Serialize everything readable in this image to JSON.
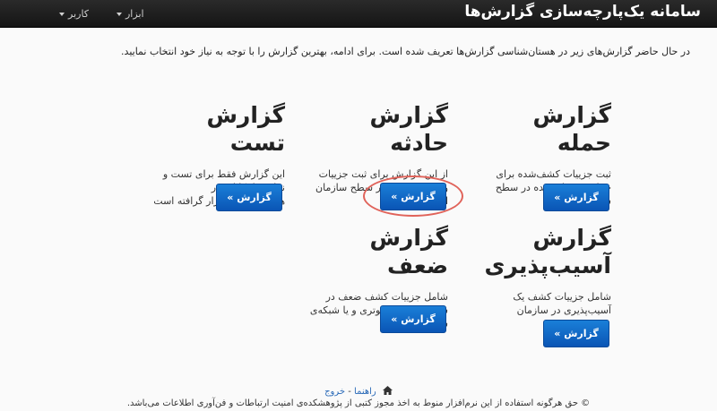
{
  "navbar": {
    "brand": "سامانه یک‌پارچه‌سازی گزارش‌ها",
    "menu_tools": "ابزار",
    "menu_user": "کاربر"
  },
  "intro": "در حال حاضر گزارش‌های زیر در هستان‌شناسی گزارش‌ها تعریف شده است. برای ادامه، بهترین گزارش را با توجه به نیاز خود انتخاب نمایید.",
  "reports": {
    "attack": {
      "title": "گزارش حمله",
      "desc": "ثبت جزییات کشف‌شده برای حمله‌ی رخ‌داده‌شده در سطح سازمان",
      "button": "گزارش »"
    },
    "incident": {
      "title": "گزارش حادثه",
      "desc": "از این گزارش برای ثبت جزییات وقوع یک حادثه در سطح سازمان استفاده نمایید",
      "button": "گزارش »"
    },
    "test": {
      "title": "گزارش تست",
      "desc": "این گزارش فقط برای تست و نمایش امکانات در هستان‌شناسی قرار گرافته است",
      "button": "گزارش »"
    },
    "vulnerability": {
      "title": "گزارش آسیب‌پذیری",
      "desc": "شامل جزییات کشف یک آسیب‌پذیری در سازمان",
      "button": "گزارش »"
    },
    "weakness": {
      "title": "گزارش ضعف",
      "desc": "شامل جزییات کشف ضعف در سیستم‌های کامپیوتری و یا شبکه‌ی سازمان",
      "button": "گزارش »"
    }
  },
  "footer": {
    "help": "راهنما",
    "separator": " - ",
    "logout": "خروج",
    "copyright": "© حق هرگونه استفاده از این نرم‌افزار منوط به اخذ مجوز کتبی از پژوهشکده‌ی امنیت ارتباطات و فن‌آوری اطلاعات می‌باشد."
  }
}
